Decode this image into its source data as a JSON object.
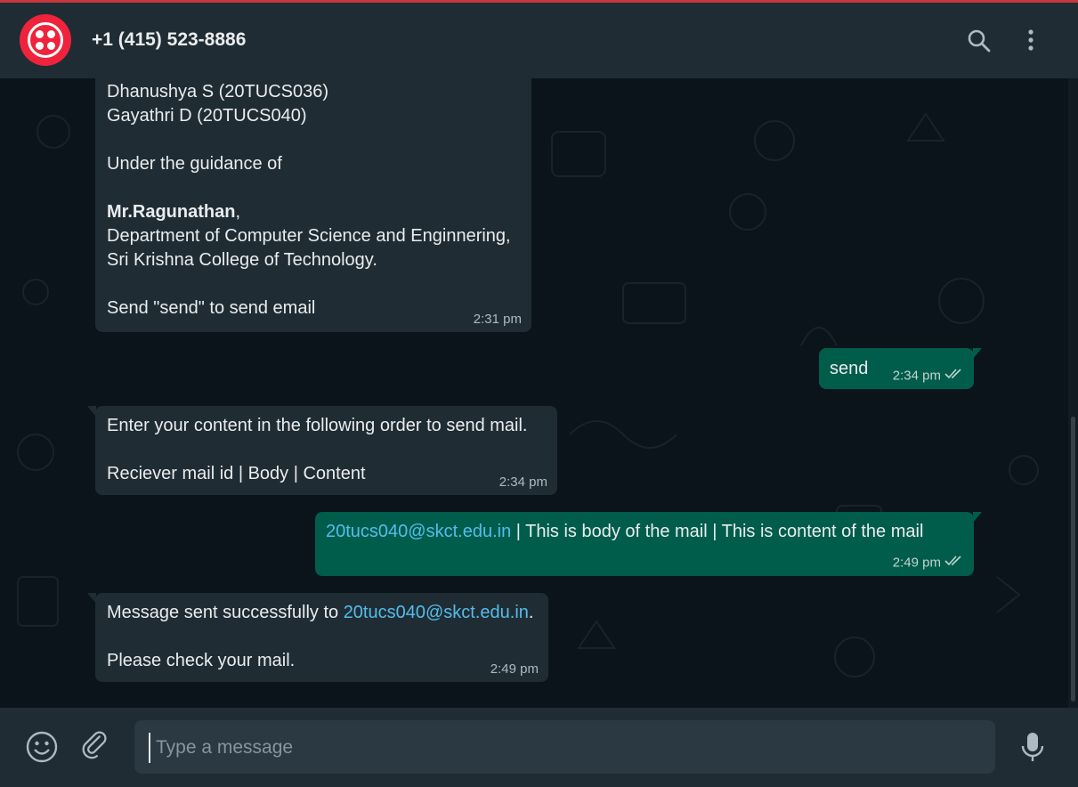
{
  "header": {
    "contact_name": "+1 (415) 523-8886",
    "icons": [
      "search-icon",
      "menu-dots-icon"
    ],
    "accent_color": "#ef233c"
  },
  "messages": [
    {
      "direction": "incoming",
      "lines": [
        "Dhanushya S (20TUCS036)",
        "Gayathri D (20TUCS040)",
        "",
        "Under the guidance of",
        "",
        "Mr.Ragunathan,",
        "Department of Computer Science and Enginnering,",
        "Sri Krishna College of Technology.",
        "",
        "Send \"send\" to send email"
      ],
      "bold_name": "Mr.Ragunathan",
      "bold_suffix": ",",
      "time": "2:31 pm"
    },
    {
      "direction": "outgoing",
      "text": "send",
      "time": "2:34 pm",
      "status": "read"
    },
    {
      "direction": "incoming",
      "lines": [
        "Enter your content in the following order to send mail.",
        "",
        "Reciever mail id | Body | Content"
      ],
      "time": "2:34 pm"
    },
    {
      "direction": "outgoing",
      "link": "20tucs040@skct.edu.in",
      "text": " | This is body of the mail | This is content of the mail",
      "time": "2:49 pm",
      "status": "read"
    },
    {
      "direction": "incoming",
      "prefix": "Message sent successfully to ",
      "link": "20tucs040@skct.edu.in",
      "suffix": ".",
      "line2": "Please check your mail.",
      "time": "2:49 pm"
    }
  ],
  "composer": {
    "placeholder": "Type a message",
    "value": "",
    "icons": [
      "emoji-icon",
      "attach-icon",
      "microphone-icon"
    ]
  }
}
